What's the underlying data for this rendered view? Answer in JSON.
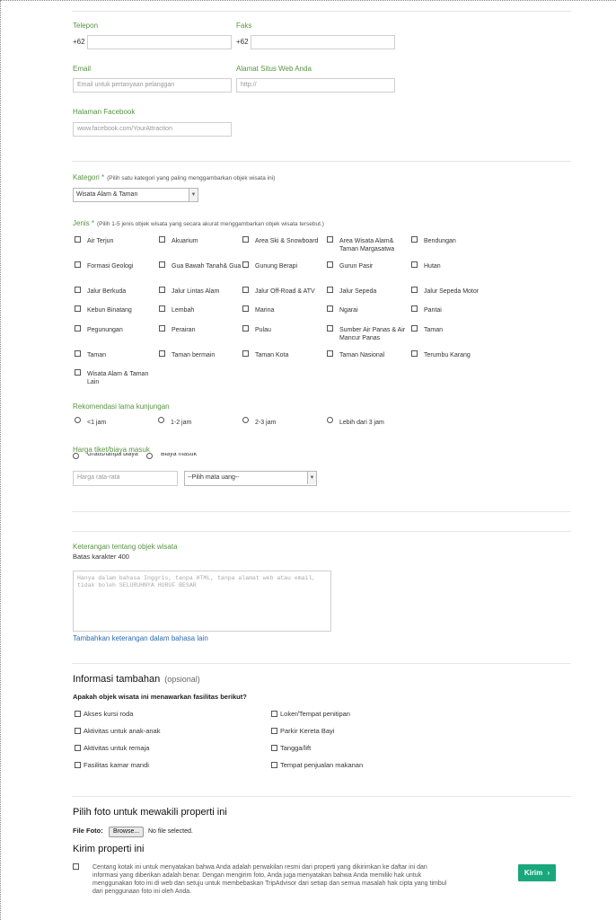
{
  "contact": {
    "phone_label": "Telepon",
    "phone_prefix": "+62",
    "fax_label": "Faks",
    "fax_prefix": "+62",
    "email_label": "Email",
    "email_placeholder": "Email untuk pertanyaan pelanggan",
    "website_label": "Alamat Situs Web Anda",
    "website_placeholder": "http://",
    "facebook_label": "Halaman Facebook",
    "facebook_placeholder": "www.facebook.com/YourAttraction"
  },
  "category": {
    "label": "Kategori *",
    "hint": "(Pilih satu kategori yang paling menggambarkan objek wisata ini)",
    "selected": "Wisata Alam & Taman"
  },
  "types": {
    "label": "Jenis *",
    "hint": "(Pilih 1-5 jenis objek wisata yang secara akurat menggambarkan objek wisata tersebut.)",
    "options": [
      "Air Terjun",
      "Akuarium",
      "Area Ski & Snowboard",
      "Area Wisata Alam& Taman Margasatwa",
      "Bendungan",
      "Formasi Geologi",
      "Gua Bawah Tanah& Gua",
      "Gunung Berapi",
      "Gurun Pasir",
      "Hutan",
      "Jalur Berkuda",
      "Jalur Lintas Alam",
      "Jalur Off-Road & ATV",
      "Jalur Sepeda",
      "Jalur Sepeda Motor",
      "Kebun Binatang",
      "Lembah",
      "Marina",
      "Ngarai",
      "Pantai",
      "Pegunungan",
      "Perairan",
      "Pulau",
      "Sumber Air Panas & Air Mancur Panas",
      "Taman",
      "Taman",
      "Taman bermain",
      "Taman Kota",
      "Taman Nasional",
      "Terumbu Karang",
      "Wisata Alam & Taman Lain"
    ]
  },
  "duration": {
    "label": "Rekomendasi lama kunjungan",
    "options": [
      "<1 jam",
      "1-2 jam",
      "2-3 jam",
      "Lebih dari 3 jam"
    ]
  },
  "price": {
    "label": "Harga tiket/biaya masuk",
    "free_label": "Gratis/tanpa biaya",
    "paid_label": "Biaya masuk",
    "average_placeholder": "Harga rata-rata",
    "currency_selected": "--Pilih mata uang--"
  },
  "description": {
    "label": "Keterangan tentang objek wisata",
    "limit": "Batas karakter 400",
    "placeholder": "Hanya dalam bahasa Inggris, tanpa HTML, tanpa alamat web atau email, tidak boleh SELURUHNYA HURUF BESAR",
    "add_language_link": "Tambahkan keterangan dalam bahasa lain"
  },
  "additional": {
    "title": "Informasi tambahan",
    "optional": "(opsional)",
    "question": "Apakah objek wisata ini menawarkan fasilitas berikut?",
    "facilities_left": [
      "Akses kursi roda",
      "Aktivitas untuk anak-anak",
      "Aktivitas untuk remaja",
      "Fasilitas kamar mandi"
    ],
    "facilities_right": [
      "Loker/Tempat penitipan",
      "Parkir Kereta Bayi",
      "Tangga/lift",
      "Tempat penjualan makanan"
    ]
  },
  "photo": {
    "title": "Pilih foto untuk mewakili properti ini",
    "file_label": "File Foto:",
    "browse_label": "Browse...",
    "no_file": "No file selected."
  },
  "submit": {
    "title": "Kirim properti ini",
    "legal": "Centang kotak ini untuk menyatakan bahwa Anda adalah perwakilan resmi dari properti yang dikirimkan ke daftar ini dan informasi yang diberikan adalah benar. Dengan mengirim foto, Anda juga menyatakan bahwa Anda memiliki hak untuk menggunakan foto ini di web dan setuju untuk membebaskan TripAdvisor dari setiap dan semua masalah hak cipta yang timbul dari penggunaan foto ini oleh Anda.",
    "button_label": "Kirim",
    "button_icon": "chevron-right-icon"
  }
}
